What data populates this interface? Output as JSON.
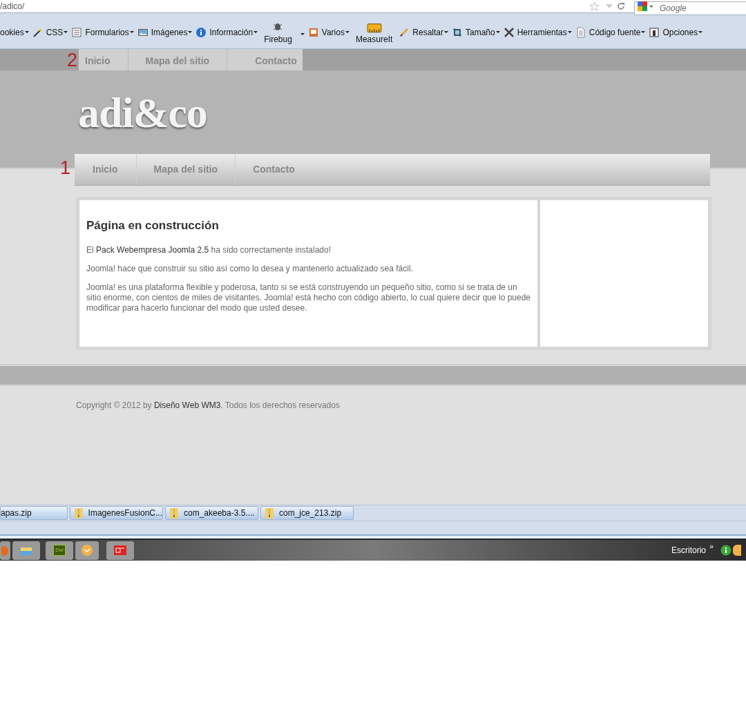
{
  "address_bar": {
    "url": "/adico/",
    "search_placeholder": "Google"
  },
  "toolbar": [
    {
      "label": "ookies",
      "kind": "inline",
      "dropdown": true
    },
    {
      "label": "CSS",
      "kind": "inline",
      "dropdown": true
    },
    {
      "label": "Formularios",
      "kind": "inline",
      "dropdown": true
    },
    {
      "label": "Imágenes",
      "kind": "inline",
      "dropdown": true
    },
    {
      "label": "Información",
      "kind": "inline",
      "dropdown": true
    },
    {
      "label": "Firebug",
      "kind": "stacked",
      "dropdown": true
    },
    {
      "label": "Varios",
      "kind": "inline",
      "dropdown": true
    },
    {
      "label": "MeasureIt",
      "kind": "stacked",
      "dropdown": false
    },
    {
      "label": "Resaltar",
      "kind": "inline",
      "dropdown": true
    },
    {
      "label": "Tamaño",
      "kind": "inline",
      "dropdown": true
    },
    {
      "label": "Herramientas",
      "kind": "inline",
      "dropdown": true
    },
    {
      "label": "Código fuente",
      "kind": "inline",
      "dropdown": true
    },
    {
      "label": "Opciones",
      "kind": "inline",
      "dropdown": true
    }
  ],
  "top_menu": {
    "marker": "2",
    "items": [
      "Inicio",
      "Mapa del sitio",
      "Contacto"
    ]
  },
  "logo": "adi&co",
  "main_menu": {
    "marker": "1",
    "items": [
      "Inicio",
      "Mapa del sitio",
      "Contacto"
    ]
  },
  "article": {
    "title": "Página en construcción",
    "paragraphs": [
      [
        {
          "text": "El ",
          "link": false
        },
        {
          "text": "Pack Webempresa Joomla 2.5",
          "link": true
        },
        {
          "text": " ha sido correctamente instalado!",
          "link": false
        }
      ],
      [
        {
          "text": "Joomla! hace que construir su sitio así como lo desea y mantenerlo actualizado sea fácil.",
          "link": false
        }
      ],
      [
        {
          "text": "Joomla! es una plataforma flexible y poderosa, tanto si se está construyendo un pequeño sitio, como si se trata de un sitio enorme, con cientos de miles de visitantes. Joomla! está hecho con código abierto, lo cual quiere decir que lo puede modificar para hacerlo funcionar del modo que usted desee.",
          "link": false
        }
      ]
    ]
  },
  "footer": [
    {
      "text": "Copyright © 2012 by ",
      "link": false
    },
    {
      "text": "Diseño Web WM3",
      "link": true
    },
    {
      "text": ". Todos los derechos reservados",
      "link": false
    }
  ],
  "downloads": [
    "apas.zip",
    "ImagenesFusionC...",
    "com_akeeba-3.5....",
    "com_jce_213.zip"
  ],
  "taskbar": {
    "desktop_label": "Escritorio",
    "chevron": "»",
    "dw_label": "Dw"
  }
}
